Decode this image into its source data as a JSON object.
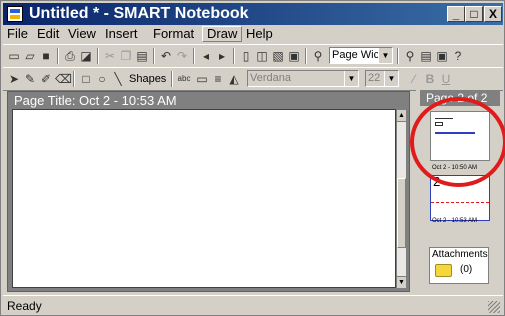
{
  "window": {
    "title": "Untitled * - SMART Notebook",
    "controls": {
      "minimize": "_",
      "maximize": "□",
      "close": "X"
    }
  },
  "menu": [
    "File",
    "Edit",
    "View",
    "Insert",
    "Format",
    "Draw",
    "Help"
  ],
  "menu_active": "Draw",
  "toolbar1": {
    "icons": [
      "new-icon",
      "open-icon",
      "save-icon",
      "print-icon",
      "print-preview-icon",
      "cut-icon",
      "copy-icon",
      "paste-icon",
      "undo-icon",
      "redo-icon",
      "previous-page-icon",
      "next-page-icon",
      "insert-blank-page-icon",
      "clone-page-icon",
      "delete-page-icon",
      "capture-icon",
      "zoom-icon",
      "screen-shade-icon",
      "full-screen-icon",
      "help-icon"
    ],
    "zoom_value": "Page Wic"
  },
  "toolbar2": {
    "shapes_label": "Shapes",
    "font_value": "Verdana",
    "size_value": "22",
    "text_style_labels": {
      "bold": "B",
      "underline": "U"
    }
  },
  "page": {
    "title": "Page Title: Oct 2 - 10:53 AM"
  },
  "sorter": {
    "header": "Page 2 of 2",
    "thumbnails": [
      {
        "label": "Oct 2 - 10:50 AM"
      },
      {
        "label": "Oct 2 - 10:53 AM",
        "content": "2"
      }
    ]
  },
  "attachments": {
    "label": "Attachments",
    "count": "(0)"
  },
  "status": "Ready",
  "colors": {
    "titlebar": "#0a246a",
    "highlight_circle": "#e01b1b",
    "chrome": "#d4d0c8"
  }
}
